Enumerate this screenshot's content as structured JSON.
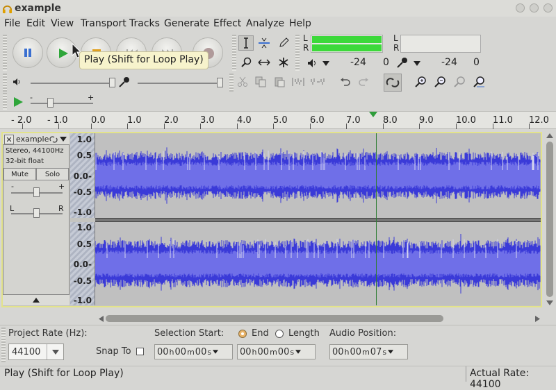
{
  "window": {
    "title": "example"
  },
  "menu": [
    "File",
    "Edit",
    "View",
    "Transport",
    "Tracks",
    "Generate",
    "Effect",
    "Analyze",
    "Help"
  ],
  "meters": {
    "rec_left": "L",
    "rec_right": "R",
    "play_left": "L",
    "play_right": "R",
    "scale": [
      "-24",
      "0",
      "-24",
      "0"
    ]
  },
  "ruler": {
    "ticks": [
      "- 2.0",
      "- 1.0",
      "0.0",
      "1.0",
      "2.0",
      "3.0",
      "4.0",
      "5.0",
      "6.0",
      "7.0",
      "8.0",
      "9.0",
      "10.0",
      "11.0",
      "12.0"
    ]
  },
  "track": {
    "name": "example",
    "info1": "Stereo, 44100Hz",
    "info2": "32-bit float",
    "mute": "Mute",
    "solo": "Solo",
    "gain_minus": "-",
    "gain_plus": "+",
    "pan_left": "L",
    "pan_right": "R",
    "vruler": [
      "1.0",
      "0.5",
      "0.0-",
      "-0.5",
      "-1.0"
    ]
  },
  "tooltip": "Play (Shift for Loop Play)",
  "selection": {
    "project_rate_label": "Project Rate (Hz):",
    "project_rate": "44100",
    "snap_to": "Snap To",
    "selection_start_label": "Selection Start:",
    "end_label": "End",
    "length_label": "Length",
    "audio_position_label": "Audio Position:",
    "start_time": {
      "h": "00",
      "m": "00",
      "s": "00"
    },
    "end_time": {
      "h": "00",
      "m": "00",
      "s": "00"
    },
    "audio_time": {
      "h": "00",
      "m": "00",
      "s": "07"
    }
  },
  "status": {
    "left": "Play (Shift for Loop Play)",
    "right": "Actual Rate: 44100"
  },
  "colors": {
    "waveform": "#3a3ad8",
    "waveform_rms": "#6f6fe8",
    "meter": "#3cd93a",
    "track_border": "#e3e38a",
    "cursor": "#2e7d32"
  }
}
